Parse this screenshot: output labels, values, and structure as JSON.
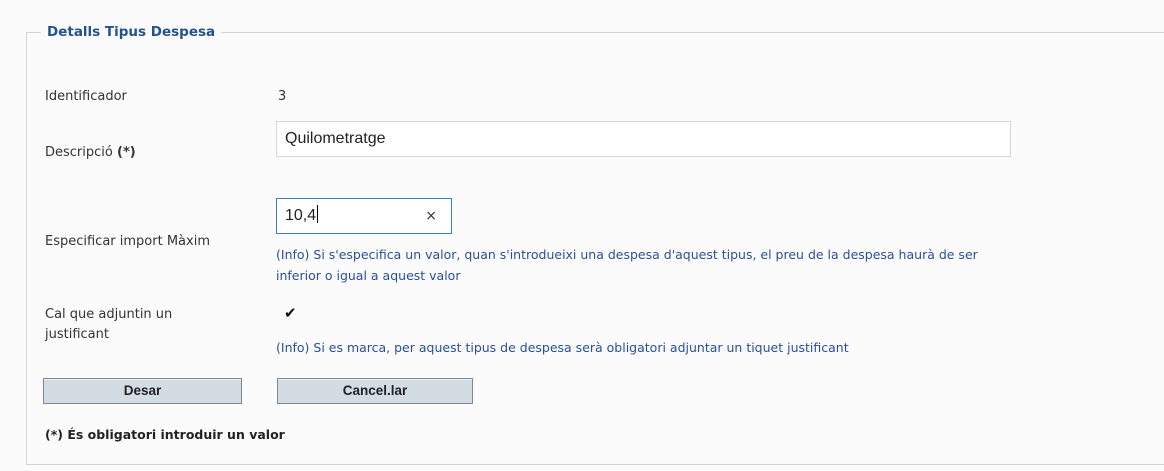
{
  "section": {
    "legend": "Detalls Tipus Despesa"
  },
  "form": {
    "identificador": {
      "label": "Identificador",
      "value": "3"
    },
    "descripcio": {
      "label": "Descripció",
      "required_mark": "(*)",
      "value": "Quilometratge"
    },
    "import_maxim": {
      "label": "Especificar import Màxim",
      "value": "10,4",
      "clear_icon": "×",
      "info_line1": "(Info) Si s'especifica un valor, quan s'introdueixi una despesa d'aquest tipus, el preu de la despesa haurà de ser",
      "info_line2": "inferior o igual a aquest valor"
    },
    "justificant": {
      "label_line1": "Cal que adjuntin un",
      "label_line2": "justificant",
      "checked": true,
      "check_glyph": "✔",
      "info": "(Info) Si es marca, per aquest tipus de despesa serà obligatori adjuntar un tiquet justificant"
    }
  },
  "buttons": {
    "save": "Desar",
    "cancel": "Cancel.lar"
  },
  "footnote": "(*) És obligatori introduir un valor"
}
